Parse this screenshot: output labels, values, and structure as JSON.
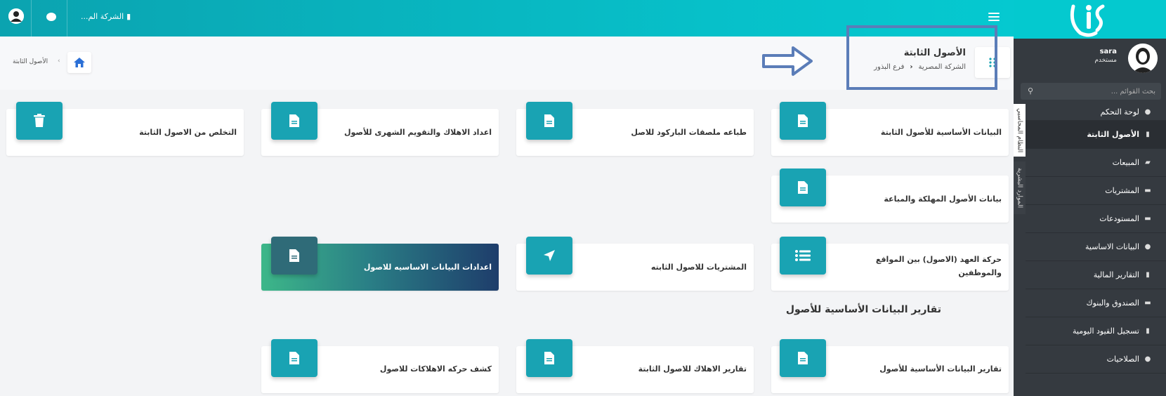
{
  "topbar": {
    "company": "الشركة الم..."
  },
  "sidebar": {
    "user": {
      "name": "sara",
      "role": "مستخدم"
    },
    "search_placeholder": "بحث القوائم ...",
    "tabs": [
      "النظام المحاسبي",
      "الموارد البشرية"
    ],
    "items": [
      {
        "label": "لوحة التحكم",
        "icon": "dashboard-icon"
      },
      {
        "label": "الأصول الثابتة",
        "icon": "file-icon",
        "active": true
      },
      {
        "label": "المبيعات",
        "icon": "truck-icon"
      },
      {
        "label": "المشتريات",
        "icon": "money-icon"
      },
      {
        "label": "المستودعات",
        "icon": "warehouse-icon"
      },
      {
        "label": "البيانات الاساسية",
        "icon": "info-icon"
      },
      {
        "label": "التقارير المالية",
        "icon": "file-icon"
      },
      {
        "label": "الصندوق والبنوك",
        "icon": "money-icon"
      },
      {
        "label": "تسجيل القيود اليومية",
        "icon": "file-icon"
      },
      {
        "label": "الصلاحيات",
        "icon": "users-icon"
      }
    ]
  },
  "header": {
    "title": "الأصول الثابتة",
    "company": "الشركة المصرية",
    "branch": "فرع البذور",
    "breadcrumb": "الأصول الثابتة"
  },
  "cards": [
    {
      "label": "البيانات الأساسية للأصول الثابتة",
      "icon": "file-icon"
    },
    {
      "label": "طباعه ملصقات الباركود للاصل",
      "icon": "file-icon"
    },
    {
      "label": "اعداد الاهلاك والتقويم الشهرى للأصول",
      "icon": "file-icon"
    },
    {
      "label": "التخلص من الاصول الثابتة",
      "icon": "trash-icon"
    },
    {
      "label": "بيانات الأصول المهلكة والمباعة",
      "icon": "file-icon"
    },
    {
      "label": "حركة العهد (الاصول) بين المواقع والموظفين",
      "icon": "list-icon"
    },
    {
      "label": "المشتريات للاصول الثابته",
      "icon": "navigation-icon"
    },
    {
      "label": "اعدادات البيانات الاساسيه للاصول",
      "icon": "file-icon"
    }
  ],
  "reports_section": {
    "title": "تقارير البيانات الأساسية للأصول",
    "cards": [
      {
        "label": "تقارير البيانات الأساسية للأصول",
        "icon": "file-icon"
      },
      {
        "label": "تقارير الاهلاك للاصول الثابتة",
        "icon": "file-icon"
      },
      {
        "label": "كشف حركه الاهلاكات للاصول",
        "icon": "file-icon"
      }
    ]
  },
  "colors": {
    "topbar": "#07c0c9",
    "card_icon": "#19a3b3",
    "sidebar": "#353a40",
    "annotation": "#5b7db8"
  }
}
